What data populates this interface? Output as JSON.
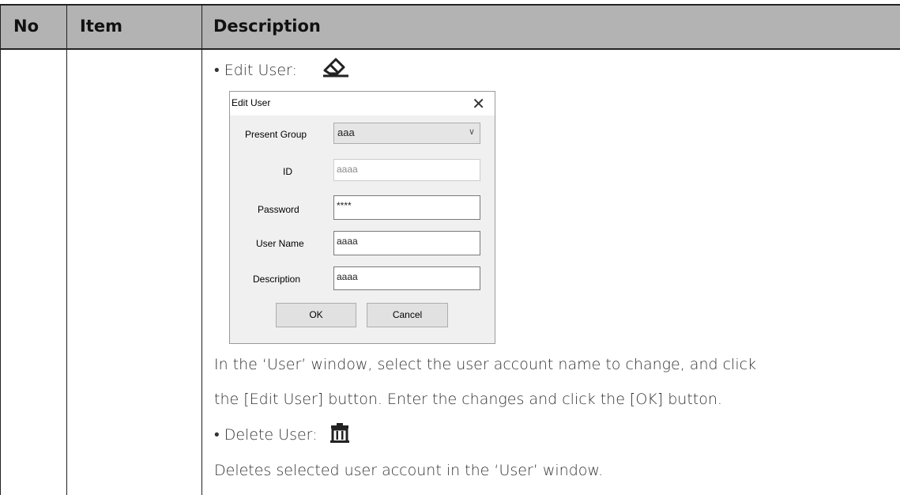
{
  "table": {
    "headers": {
      "no": "No",
      "item": "Item",
      "description": "Description"
    }
  },
  "content": {
    "edit_user_label": "• Edit User:",
    "edit_icon": "eraser-icon",
    "edit_paragraph_line1": "In the ‘User’ window, select the user account name to change, and click",
    "edit_paragraph_line2": "the [Edit User] button. Enter the changes and click the [OK] button.",
    "delete_user_label": "• Delete User:",
    "delete_icon": "trash-icon",
    "delete_paragraph": "Deletes selected user account in the ‘User’ window."
  },
  "dialog": {
    "title": "Edit User",
    "close": "✕",
    "present_group_label": "Present Group",
    "present_group_value": "aaa",
    "id_label": "ID",
    "id_value": "aaaa",
    "password_label": "Password",
    "password_value": "****",
    "user_name_label": "User Name",
    "user_name_value": "aaaa",
    "description_label": "Description",
    "description_value": "aaaa",
    "ok_label": "OK",
    "cancel_label": "Cancel"
  }
}
